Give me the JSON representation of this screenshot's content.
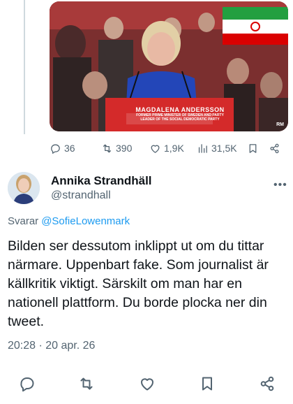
{
  "quoted_media": {
    "podium_name": "MAGDALENA ANDERSSON",
    "podium_subtitle_line1": "FORMER PRIME MINISTER OF SWEDEN AND PARTY",
    "podium_subtitle_line2": "LEADER OF THE SOCIAL DEMOCRATIC PARTY",
    "watermark": "RM"
  },
  "parent_stats": {
    "replies": "36",
    "reposts": "390",
    "likes": "1,9K",
    "views": "31,5K"
  },
  "post": {
    "author_name": "Annika Strandhäll",
    "author_handle": "@strandhall",
    "reply_label": "Svarar",
    "reply_to_handle": "@SofieLowenmark",
    "text": "Bilden ser dessutom inklippt ut om du tittar närmare. Uppenbart fake. Som journalist är källkritik viktigt. Särskilt om man har en nationell plattform. Du borde plocka ner din tweet.",
    "timestamp": "20:28 · 20 apr. 26"
  },
  "icons": {
    "reply": "reply-icon",
    "repost": "repost-icon",
    "like": "heart-icon",
    "views": "views-icon",
    "bookmark": "bookmark-icon",
    "share": "share-icon",
    "more": "more-icon"
  },
  "colors": {
    "accent": "#1d9bf0",
    "secondary_text": "#536471",
    "podium_red": "#d42a2a"
  }
}
